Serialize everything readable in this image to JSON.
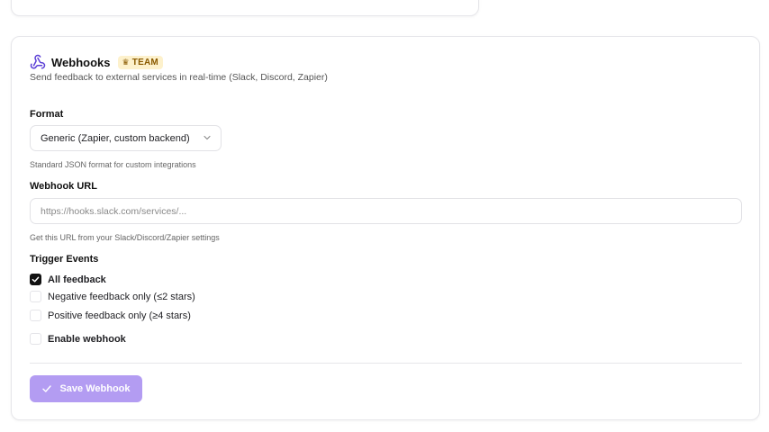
{
  "webhooks": {
    "title": "Webhooks",
    "badge": "TEAM",
    "badge_icon": "crown-icon",
    "subtitle": "Send feedback to external services in real-time (Slack, Discord, Zapier)",
    "format": {
      "label": "Format",
      "selected": "Generic (Zapier, custom backend)",
      "hint": "Standard JSON format for custom integrations"
    },
    "url": {
      "label": "Webhook URL",
      "value": "",
      "placeholder": "https://hooks.slack.com/services/...",
      "hint": "Get this URL from your Slack/Discord/Zapier settings"
    },
    "trigger_events": {
      "label": "Trigger Events",
      "options": [
        {
          "label": "All feedback",
          "checked": true
        },
        {
          "label": "Negative feedback only (≤2 stars)",
          "checked": false
        },
        {
          "label": "Positive feedback only (≥4 stars)",
          "checked": false
        }
      ]
    },
    "enable": {
      "label": "Enable webhook",
      "checked": false
    },
    "save_label": "Save Webhook"
  },
  "colors": {
    "accent": "#b39cf2",
    "badge_bg": "#fdf1cc",
    "badge_text": "#8a5a00",
    "icon": "#5b3fd6"
  }
}
